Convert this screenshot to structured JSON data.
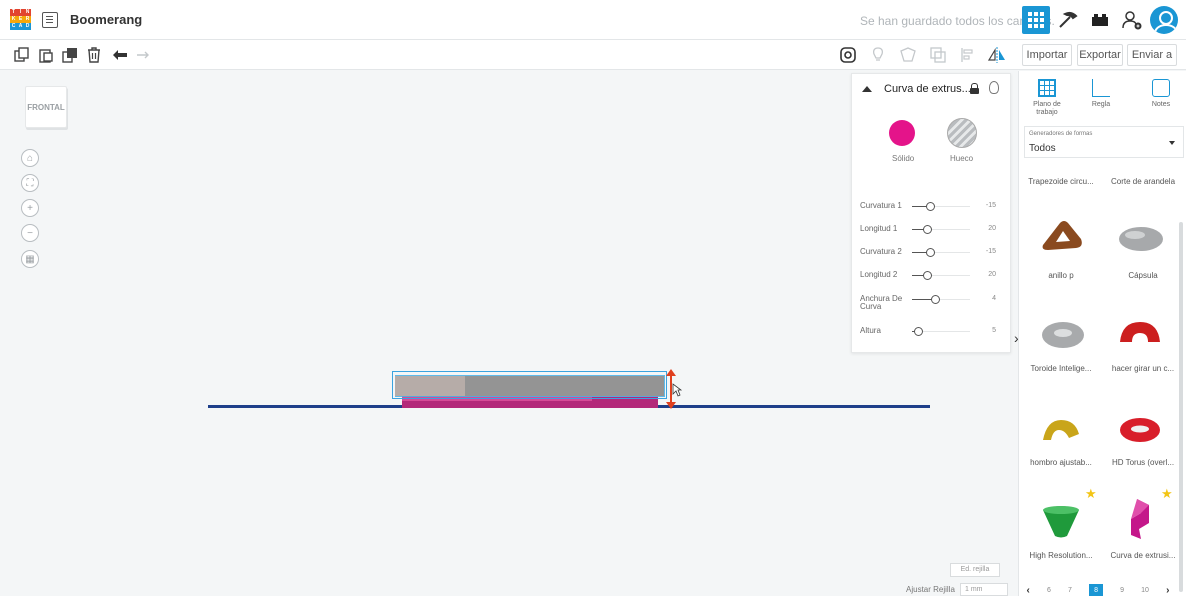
{
  "app": {
    "logo_letters": [
      "T",
      "I",
      "N",
      "K",
      "E",
      "R",
      "C",
      "A",
      "D"
    ],
    "title": "Boomerang",
    "save_status": "Se han guardado todos los cambios."
  },
  "toolbar": {
    "import_label": "Importar",
    "export_label": "Exportar",
    "send_label": "Enviar a"
  },
  "view": {
    "cube_label": "FRONTAL",
    "edit_grid_label": "Ed. rejilla",
    "snap_label": "Ajustar Rejilla",
    "snap_value": "1 mm"
  },
  "inspector": {
    "shape_name": "Curva de extrus...",
    "solid_label": "Sólido",
    "hole_label": "Hueco",
    "params": [
      {
        "label": "Curvatura 1",
        "value": "-15",
        "fraction": 0.25
      },
      {
        "label": "Longitud 1",
        "value": "20",
        "fraction": 0.2
      },
      {
        "label": "Curvatura 2",
        "value": "-15",
        "fraction": 0.25
      },
      {
        "label": "Longitud 2",
        "value": "20",
        "fraction": 0.2
      },
      {
        "label": "Anchura De Curva",
        "value": "4",
        "fraction": 0.35
      },
      {
        "label": "Altura",
        "value": "5",
        "fraction": 0.05
      }
    ]
  },
  "rpanel": {
    "tools": [
      {
        "label": "Plano de trabajo"
      },
      {
        "label": "Regla"
      },
      {
        "label": "Notes"
      }
    ],
    "generators_label": "Generadores de formas",
    "generators_value": "Todos",
    "shapes": [
      {
        "name": "Trapezoide circu...",
        "color": "#888888"
      },
      {
        "name": "Corte de arandela",
        "color": "#888888"
      },
      {
        "name": "anillo p",
        "color": "#8a4a1f"
      },
      {
        "name": "Cápsula",
        "color": "#9ea0a2"
      },
      {
        "name": "Toroide Intelige...",
        "color": "#a0a2a4"
      },
      {
        "name": "hacer girar un c...",
        "color": "#cc1f1f"
      },
      {
        "name": "hombro ajustab...",
        "color": "#c9a51a"
      },
      {
        "name": "HD Torus (overl...",
        "color": "#d81e2a"
      },
      {
        "name": "High Resolution...",
        "color": "#1f9a3b"
      },
      {
        "name": "Curva de extrusi...",
        "color": "#c4178a"
      }
    ],
    "pages": [
      "6",
      "7",
      "8",
      "9",
      "10"
    ],
    "current_page": "8"
  },
  "colors": {
    "accent": "#1a96d4",
    "solid": "#e4148a",
    "workplane_line": "#1e3f8a",
    "height_arrow": "#e0401f"
  }
}
